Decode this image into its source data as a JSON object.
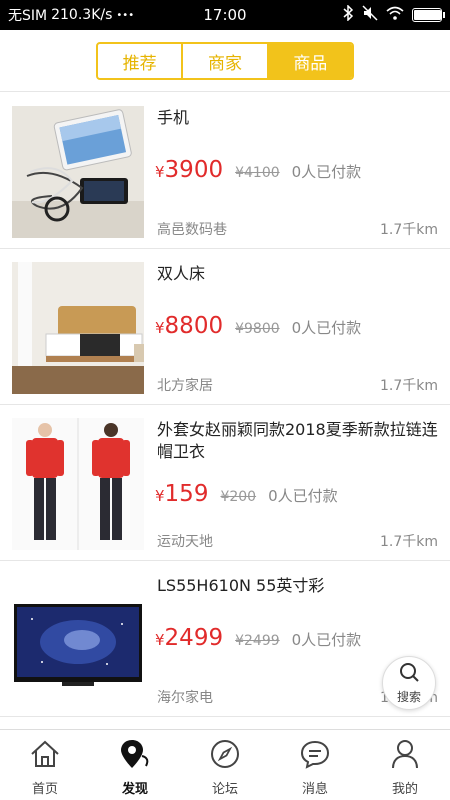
{
  "status_bar": {
    "carrier": "无SIM",
    "speed": "210.3K/s",
    "more": "•••",
    "time": "17:00",
    "battery_level": 0.95
  },
  "segment": {
    "tabs": [
      {
        "label": "推荐",
        "active": false
      },
      {
        "label": "商家",
        "active": false
      },
      {
        "label": "商品",
        "active": true
      }
    ]
  },
  "currency_symbol": "¥",
  "products": [
    {
      "name": "手机",
      "price": "3900",
      "old_price": "¥4100",
      "paid": "0人已付款",
      "shop": "高邑数码巷",
      "distance": "1.7千km",
      "image_icon": "phone-tablet-photo"
    },
    {
      "name": "双人床",
      "price": "8800",
      "old_price": "¥9800",
      "paid": "0人已付款",
      "shop": "北方家居",
      "distance": "1.7千km",
      "image_icon": "bed-photo"
    },
    {
      "name": "外套女赵丽颖同款2018夏季新款拉链连帽卫衣",
      "price": "159",
      "old_price": "¥200",
      "paid": "0人已付款",
      "shop": "运动天地",
      "distance": "1.7千km",
      "image_icon": "hoodie-photo"
    },
    {
      "name": " LS55H610N 55英寸彩",
      "price": "2499",
      "old_price": "¥2499",
      "paid": "0人已付款",
      "shop": "海尔家电",
      "distance": "1.7千km",
      "image_icon": "tv-photo"
    }
  ],
  "search_fab": {
    "label": "搜索",
    "icon": "search-icon"
  },
  "tabbar": {
    "items": [
      {
        "label": "首页",
        "icon": "home-icon",
        "active": false
      },
      {
        "label": "发现",
        "icon": "location-pin-icon",
        "active": true
      },
      {
        "label": "论坛",
        "icon": "compass-icon",
        "active": false
      },
      {
        "label": "消息",
        "icon": "chat-bubble-icon",
        "active": false
      },
      {
        "label": "我的",
        "icon": "user-icon",
        "active": false
      }
    ]
  },
  "colors": {
    "accent": "#f2c31b",
    "price": "#e12b2b"
  }
}
